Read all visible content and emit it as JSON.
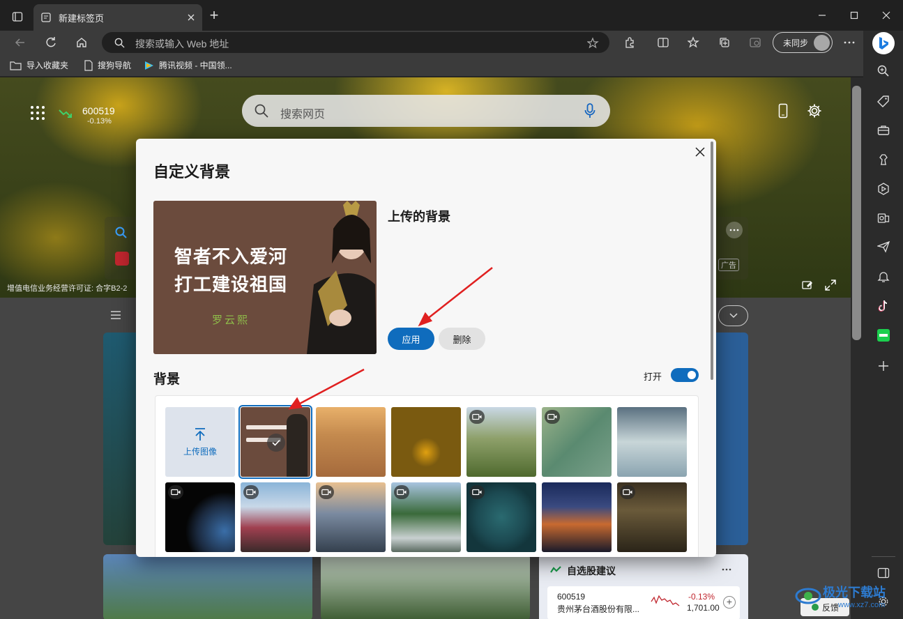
{
  "browser": {
    "tab_title": "新建标签页",
    "address_placeholder": "搜索或输入 Web 地址",
    "profile_label": "未同步"
  },
  "favorites": [
    {
      "label": "导入收藏夹",
      "icon": "folder-import-icon"
    },
    {
      "label": "搜狗导航",
      "icon": "page-icon"
    },
    {
      "label": "腾讯视频 - 中国领...",
      "icon": "tencent-video-icon"
    }
  ],
  "newtab": {
    "stock_code": "600519",
    "stock_change": "-0.13%",
    "search_placeholder": "搜索网页",
    "license_text": "增值电信业务经营许可证: 合字B2-2",
    "ad_label": "广告"
  },
  "dialog": {
    "title": "自定义背景",
    "uploaded_title": "上传的背景",
    "preview_line1": "智者不入爱河",
    "preview_line2": "打工建设祖国",
    "preview_name": "罗云熙",
    "apply_label": "应用",
    "delete_label": "删除",
    "background_title": "背景",
    "toggle_label": "打开",
    "toggle_on": true,
    "upload_label": "上传图像"
  },
  "stock_card": {
    "title": "自选股建议",
    "code": "600519",
    "name": "贵州茅台酒股份有限...",
    "change": "-0.13%",
    "price": "1,701.00"
  },
  "feedback_label": "反馈",
  "watermark": {
    "text": "极光下载站",
    "sub": "www.xz7.com"
  },
  "colors": {
    "accent": "#0f6cbd",
    "arrow": "#e02020"
  }
}
